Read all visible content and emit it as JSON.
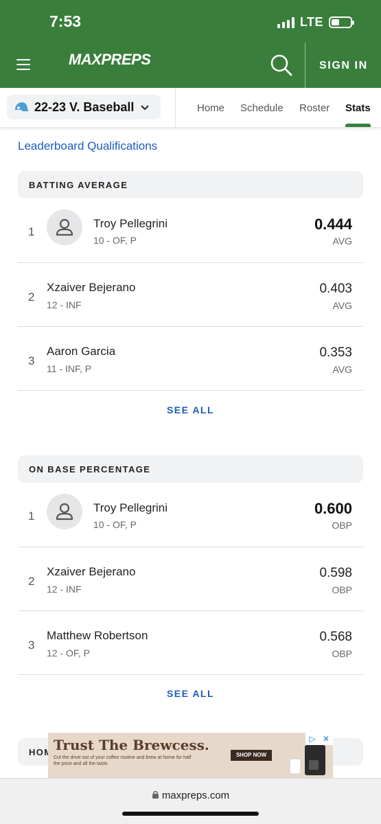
{
  "status": {
    "time": "7:53",
    "network": "LTE"
  },
  "header": {
    "logo": "MAXPREPS",
    "signin": "SIGN IN"
  },
  "subnav": {
    "team": "22-23 V. Baseball",
    "tabs": [
      "Home",
      "Schedule",
      "Roster",
      "Stats"
    ],
    "active_tab": "Stats"
  },
  "leaderboard_link": "Leaderboard Qualifications",
  "sections": [
    {
      "title": "BATTING AVERAGE",
      "see_all": "SEE ALL",
      "rows": [
        {
          "rank": "1",
          "name": "Troy Pellegrini",
          "info": "10 - OF, P",
          "value": "0.444",
          "unit": "AVG"
        },
        {
          "rank": "2",
          "name": "Xzaiver Bejerano",
          "info": "12 - INF",
          "value": "0.403",
          "unit": "AVG"
        },
        {
          "rank": "3",
          "name": "Aaron Garcia",
          "info": "11 - INF, P",
          "value": "0.353",
          "unit": "AVG"
        }
      ]
    },
    {
      "title": "ON BASE PERCENTAGE",
      "see_all": "SEE ALL",
      "rows": [
        {
          "rank": "1",
          "name": "Troy Pellegrini",
          "info": "10 - OF, P",
          "value": "0.600",
          "unit": "OBP"
        },
        {
          "rank": "2",
          "name": "Xzaiver Bejerano",
          "info": "12 - INF",
          "value": "0.598",
          "unit": "OBP"
        },
        {
          "rank": "3",
          "name": "Matthew Robertson",
          "info": "12 - OF, P",
          "value": "0.568",
          "unit": "OBP"
        }
      ]
    }
  ],
  "next_section_partial": "HOM",
  "ad": {
    "title": "Trust The Brewcess.",
    "subtitle": "Cut the drive out of your coffee routine and brew at home for half the price and all the taste.",
    "cta": "SHOP NOW"
  },
  "browser": {
    "url": "maxpreps.com"
  },
  "colors": {
    "brand_green": "#3a7e3c",
    "link_blue": "#1d5bbf"
  }
}
